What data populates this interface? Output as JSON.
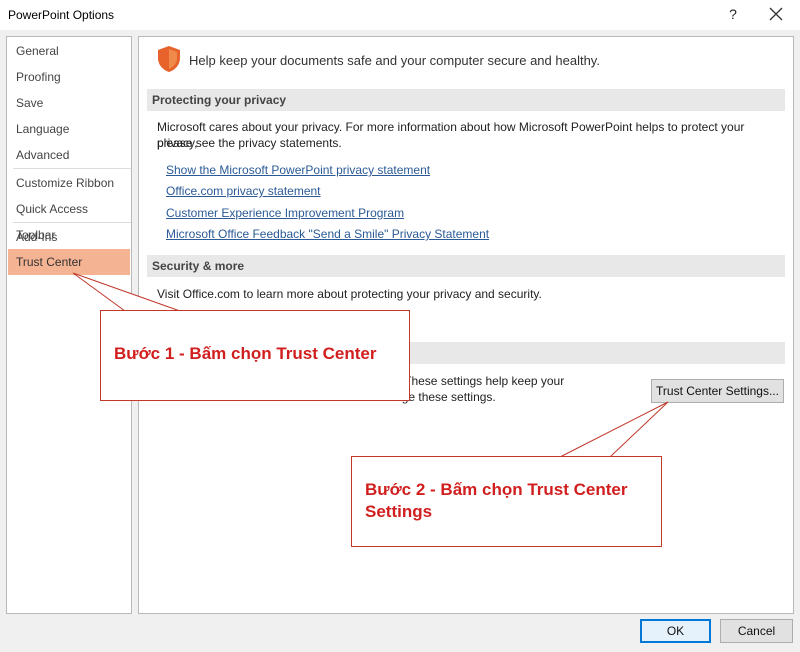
{
  "window": {
    "title": "PowerPoint Options",
    "help_glyph": "?",
    "close_icon": "close-icon"
  },
  "nav": {
    "items": [
      {
        "label": "General"
      },
      {
        "label": "Proofing"
      },
      {
        "label": "Save"
      },
      {
        "label": "Language"
      },
      {
        "label": "Advanced"
      },
      {
        "label": "Customize Ribbon"
      },
      {
        "label": "Quick Access Toolbar"
      },
      {
        "label": "Add-Ins"
      },
      {
        "label": "Trust Center",
        "selected": true
      }
    ]
  },
  "main": {
    "intro_icon": "shield-icon",
    "intro": "Help keep your documents safe and your computer secure and healthy.",
    "privacy": {
      "header": "Protecting your privacy",
      "text_line1": "Microsoft cares about your privacy. For more information about how Microsoft PowerPoint helps to protect your privacy,",
      "text_line2": "please see the privacy statements.",
      "links": [
        "Show the Microsoft PowerPoint privacy statement",
        "Office.com privacy statement",
        "Customer Experience Improvement Program",
        "Microsoft Office Feedback \"Send a Smile\" Privacy Statement"
      ]
    },
    "security": {
      "header": "Security & more",
      "text": "Visit Office.com to learn more about protecting your privacy and security."
    },
    "trust_center": {
      "text_line1_visible": "ttings. These settings help keep your",
      "text_line2_visible": "t change these settings.",
      "button_label": "Trust Center Settings..."
    }
  },
  "footer": {
    "ok_label": "OK",
    "cancel_label": "Cancel"
  },
  "annotations": {
    "step1": "Bước 1 - Bấm chọn Trust Center",
    "step2": "Bước 2 - Bấm chọn Trust Center Settings",
    "color": "#d11f1f"
  },
  "colors": {
    "selected_nav": "#f4b393",
    "link": "#2b5a96",
    "section_header_bg": "#e8e8e8",
    "shield_orange": "#e8632b"
  }
}
